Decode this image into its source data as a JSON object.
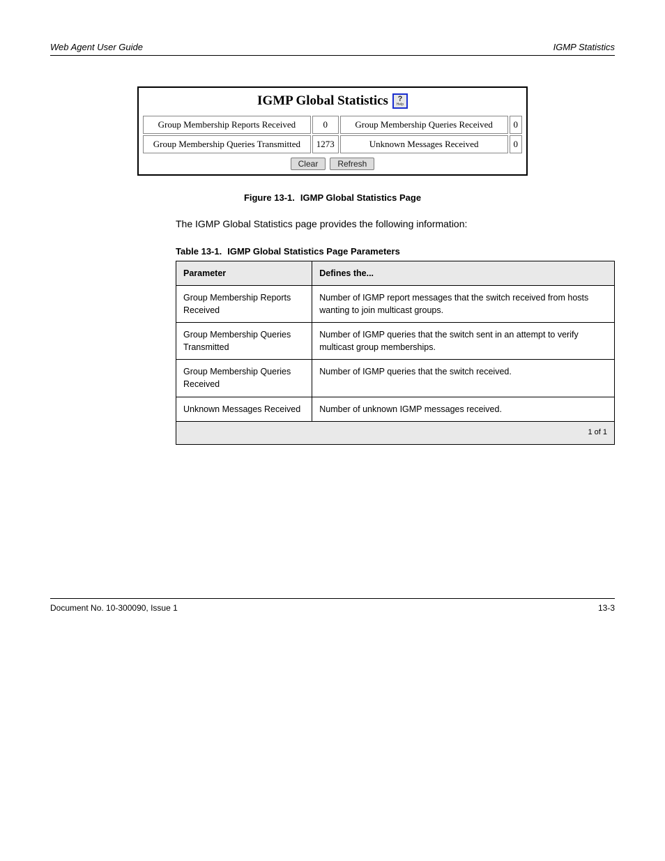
{
  "header": {
    "left": "Web Agent User Guide",
    "right": "IGMP Statistics"
  },
  "panel": {
    "title": "IGMP Global Statistics",
    "help_q": "?",
    "help_t": "Help",
    "stats": {
      "r1c1_label": "Group Membership Reports Received",
      "r1c1_val": "0",
      "r1c2_label": "Group Membership Queries Received",
      "r1c2_val": "0",
      "r2c1_label": "Group Membership Queries Transmitted",
      "r2c1_val": "1273",
      "r2c2_label": "Unknown Messages Received",
      "r2c2_val": "0"
    },
    "buttons": {
      "clear": "Clear",
      "refresh": "Refresh"
    }
  },
  "figcap": {
    "num": "Figure 13-1.",
    "text": "IGMP Global Statistics Page"
  },
  "para": "The IGMP Global Statistics page provides the following information:",
  "table": {
    "caption_num": "Table 13-1.",
    "caption_text": "IGMP Global Statistics Page Parameters",
    "head": {
      "c1": "Parameter",
      "c2": "Defines the..."
    },
    "rows": [
      {
        "c1": "Group Membership Reports Received",
        "c2": "Number of IGMP report messages that the switch received from hosts wanting to join multicast groups."
      },
      {
        "c1": "Group Membership Queries Transmitted",
        "c2": "Number of IGMP queries that the switch sent in an attempt to verify multicast group memberships."
      },
      {
        "c1": "Group Membership Queries Received",
        "c2": "Number of IGMP queries that the switch received."
      },
      {
        "c1": "Unknown Messages Received",
        "c2": "Number of unknown IGMP messages received."
      }
    ],
    "foot": "1 of 1"
  },
  "footer": {
    "left": "Document No. 10-300090, Issue 1",
    "right": "13-3"
  }
}
